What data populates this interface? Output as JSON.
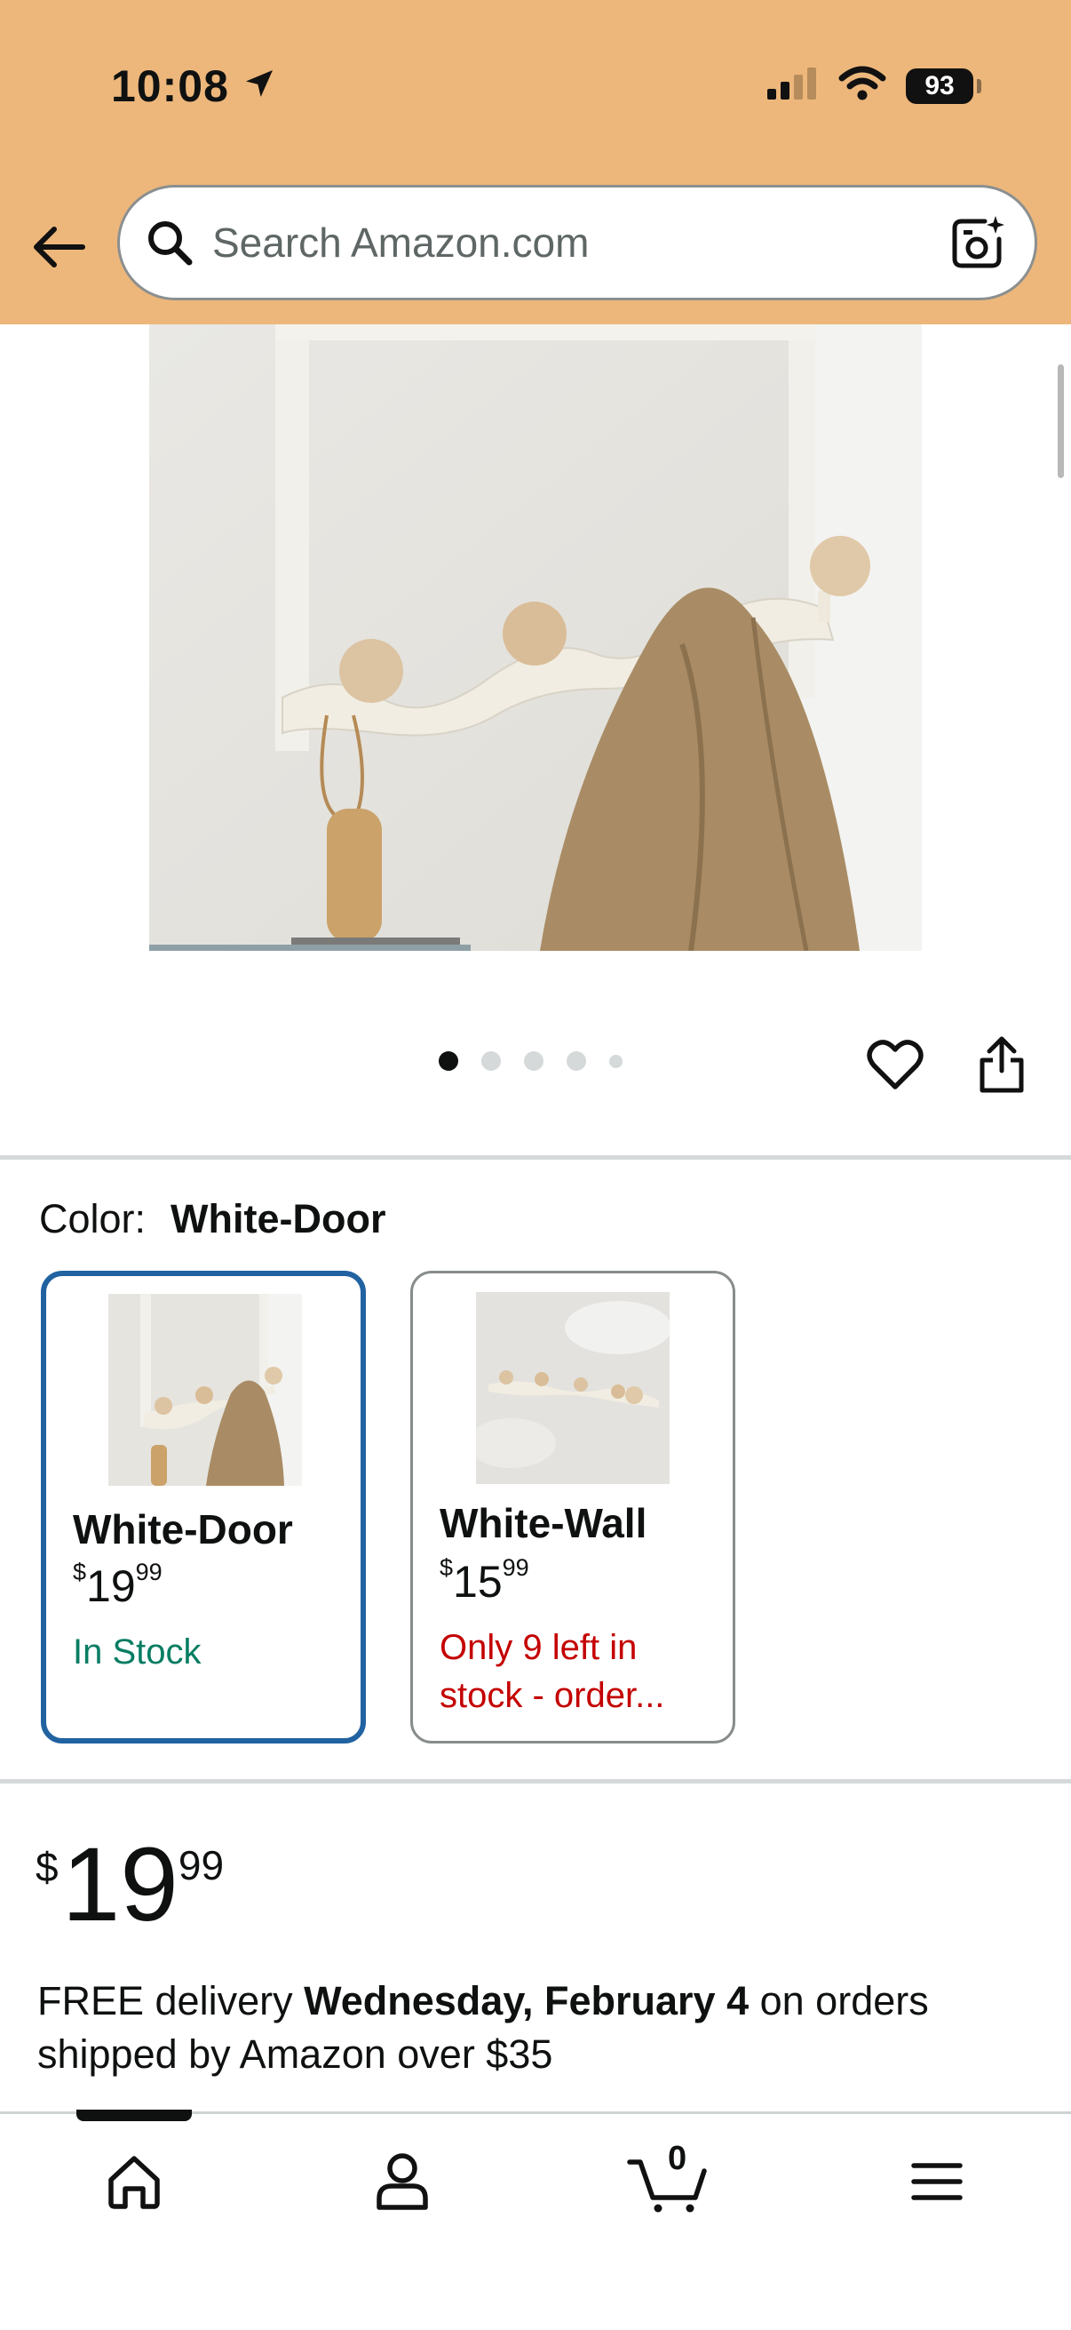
{
  "status_bar": {
    "time": "10:08",
    "battery": "93"
  },
  "search": {
    "placeholder": "Search Amazon.com"
  },
  "gallery": {
    "total_images": 5,
    "active_index": 0
  },
  "variation": {
    "label": "Color:",
    "selected_value": "White-Door",
    "options": [
      {
        "name": "White-Door",
        "price_symbol": "$",
        "price_whole": "19",
        "price_fraction": "99",
        "stock": "In Stock"
      },
      {
        "name": "White-Wall",
        "price_symbol": "$",
        "price_whole": "15",
        "price_fraction": "99",
        "stock_line1": "Only 9 left in",
        "stock_line2": "stock - order..."
      }
    ]
  },
  "price": {
    "symbol": "$",
    "whole": "19",
    "fraction": "99"
  },
  "delivery": {
    "prefix": "FREE delivery ",
    "date": "Wednesday, February 4",
    "suffix": " on orders shipped by Amazon over $35"
  },
  "tabbar": {
    "cart_count": "0",
    "items": [
      "home-icon",
      "account-icon",
      "cart-icon",
      "menu-icon"
    ]
  },
  "colors": {
    "header_bg": "#edb77b",
    "selected_border": "#2162a1",
    "in_stock": "#067d62",
    "low_stock": "#c40000"
  }
}
